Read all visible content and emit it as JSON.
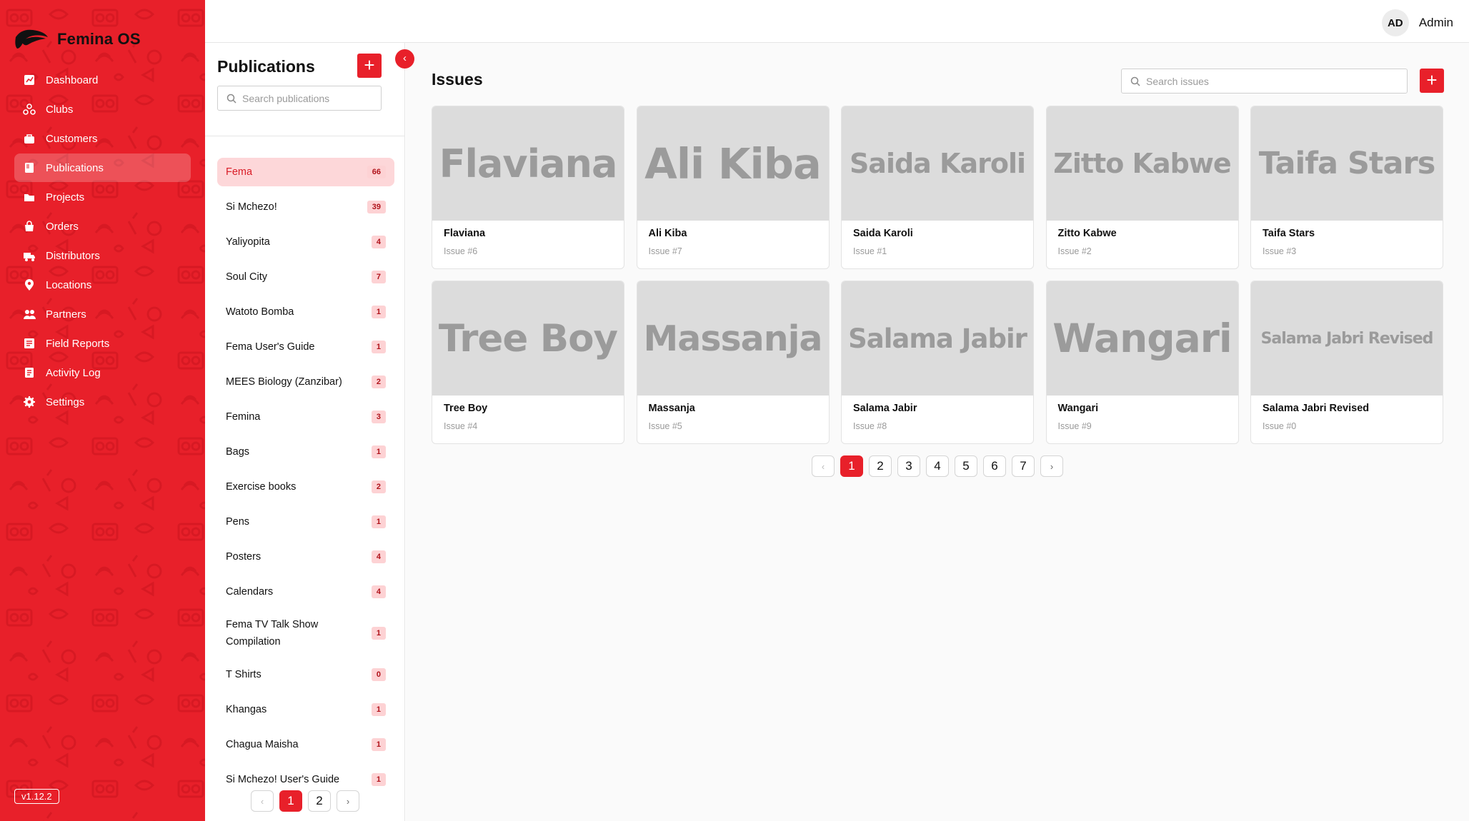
{
  "app": {
    "name": "Femina OS",
    "version": "v1.12.2",
    "colors": {
      "primary": "#e8202a",
      "primary_soft": "#fdd7d9",
      "cover": "#dcdcdc"
    }
  },
  "nav": [
    {
      "label": "Dashboard",
      "icon": "chart-icon",
      "active": false
    },
    {
      "label": "Clubs",
      "icon": "clubs-icon",
      "active": false
    },
    {
      "label": "Customers",
      "icon": "customers-icon",
      "active": false
    },
    {
      "label": "Publications",
      "icon": "book-icon",
      "active": true
    },
    {
      "label": "Projects",
      "icon": "folder-icon",
      "active": false
    },
    {
      "label": "Orders",
      "icon": "bag-icon",
      "active": false
    },
    {
      "label": "Distributors",
      "icon": "truck-icon",
      "active": false
    },
    {
      "label": "Locations",
      "icon": "pin-icon",
      "active": false
    },
    {
      "label": "Partners",
      "icon": "partners-icon",
      "active": false
    },
    {
      "label": "Field Reports",
      "icon": "report-icon",
      "active": false
    },
    {
      "label": "Activity Log",
      "icon": "log-icon",
      "active": false
    },
    {
      "label": "Settings",
      "icon": "gear-icon",
      "active": false
    }
  ],
  "user": {
    "initials": "AD",
    "name": "Admin"
  },
  "publications": {
    "title": "Publications",
    "add_label": "+",
    "search_placeholder": "Search publications",
    "items": [
      {
        "name": "Fema",
        "count": "66",
        "active": true
      },
      {
        "name": "Si Mchezo!",
        "count": "39"
      },
      {
        "name": "Yaliyopita",
        "count": "4"
      },
      {
        "name": "Soul City",
        "count": "7"
      },
      {
        "name": "Watoto Bomba",
        "count": "1"
      },
      {
        "name": "Fema User's Guide",
        "count": "1"
      },
      {
        "name": "MEES Biology (Zanzibar)",
        "count": "2"
      },
      {
        "name": "Femina",
        "count": "3"
      },
      {
        "name": "Bags",
        "count": "1"
      },
      {
        "name": "Exercise books",
        "count": "2"
      },
      {
        "name": "Pens",
        "count": "1"
      },
      {
        "name": "Posters",
        "count": "4"
      },
      {
        "name": "Calendars",
        "count": "4"
      },
      {
        "name": "Fema TV Talk Show Compilation",
        "count": "1",
        "tall": true
      },
      {
        "name": "T Shirts",
        "count": "0"
      },
      {
        "name": "Khangas",
        "count": "1"
      },
      {
        "name": "Chagua Maisha",
        "count": "1"
      },
      {
        "name": "Si Mchezo! User's Guide",
        "count": "1"
      }
    ],
    "pagination": {
      "prev": "‹",
      "pages": [
        "1",
        "2"
      ],
      "current": "1",
      "next": "›"
    }
  },
  "issues": {
    "title": "Issues",
    "add_label": "+",
    "search_placeholder": "Search issues",
    "items": [
      {
        "cover": "Flaviana",
        "title": "Flaviana",
        "issue": "Issue #6"
      },
      {
        "cover": "Ali Kiba",
        "title": "Ali Kiba",
        "issue": "Issue #7"
      },
      {
        "cover": "Saida Karoli",
        "title": "Saida Karoli",
        "issue": "Issue #1"
      },
      {
        "cover": "Zitto Kabwe",
        "title": "Zitto Kabwe",
        "issue": "Issue #2"
      },
      {
        "cover": "Taifa Stars",
        "title": "Taifa Stars",
        "issue": "Issue #3"
      },
      {
        "cover": "Tree Boy",
        "title": "Tree Boy",
        "issue": "Issue #4"
      },
      {
        "cover": "Massanja",
        "title": "Massanja",
        "issue": "Issue #5"
      },
      {
        "cover": "Salama Jabir",
        "title": "Salama Jabir",
        "issue": "Issue #8"
      },
      {
        "cover": "Wangari",
        "title": "Wangari",
        "issue": "Issue #9"
      },
      {
        "cover": "Salama Jabri Revised",
        "title": "Salama Jabri Revised",
        "issue": "Issue #0"
      }
    ],
    "pagination": {
      "prev": "‹",
      "pages": [
        "1",
        "2",
        "3",
        "4",
        "5",
        "6",
        "7"
      ],
      "current": "1",
      "next": "›"
    }
  }
}
